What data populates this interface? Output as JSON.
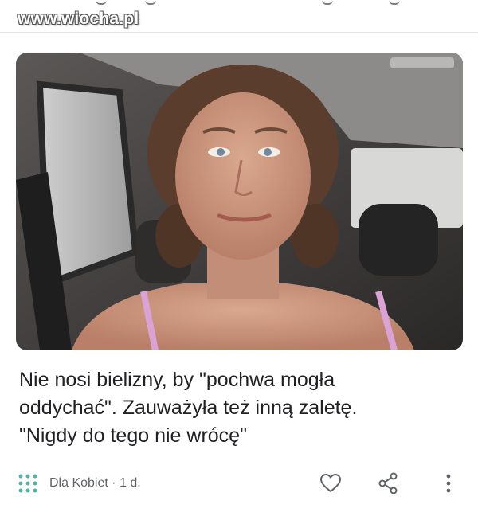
{
  "watermark": {
    "text": "www.wiocha.pl"
  },
  "article": {
    "headline_lines": [
      "Nie nosi bielizny, by \"pochwa mogła",
      "oddychać\". Zauważyła też inną zaletę.",
      "\"Nigdy do tego nie wrócę\""
    ],
    "source": "Dla Kobiet",
    "separator": "·",
    "age": "1 d."
  },
  "icons": {
    "source_logo": "dots-grid-icon",
    "like": "heart-icon",
    "share": "share-icon",
    "more": "more-vertical-icon"
  },
  "colors": {
    "text": "#202124",
    "secondary": "#5f6368",
    "logo": "#4fb3a9"
  }
}
